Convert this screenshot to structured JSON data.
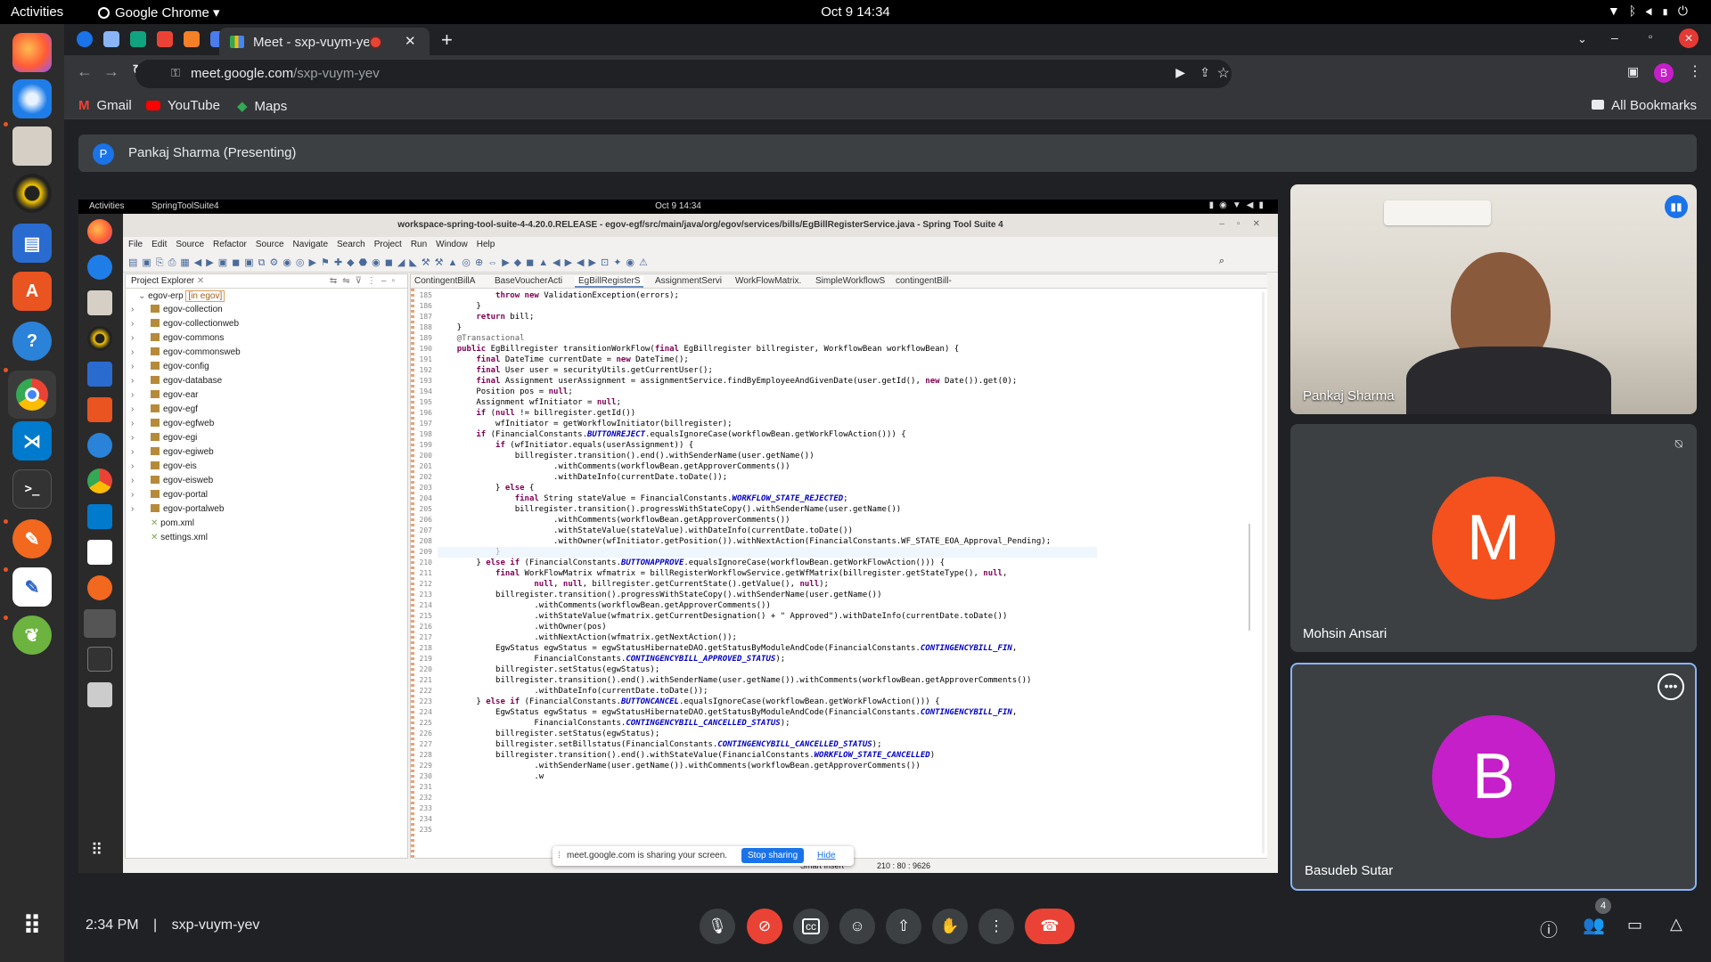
{
  "topbar": {
    "activities": "Activities",
    "app_name": "Google Chrome ▾",
    "clock": "Oct 9  14:34"
  },
  "chrome": {
    "active_tab_title": "Meet - sxp-vuym-yev",
    "new_tab": "+",
    "url_domain": "meet.google.com",
    "url_path": "/sxp-vuym-yev",
    "profile_initial": "B",
    "bookmarks": [
      {
        "label": "Gmail"
      },
      {
        "label": "YouTube"
      },
      {
        "label": "Maps"
      }
    ],
    "all_bookmarks": "All Bookmarks"
  },
  "meet": {
    "presenter_initial": "P",
    "presenter_label": "Pankaj Sharma (Presenting)",
    "time": "2:34 PM",
    "divider": "|",
    "meeting_code": "sxp-vuym-yev",
    "people_count": "4",
    "participants": [
      {
        "name": "Pankaj Sharma"
      },
      {
        "name": "Mohsin Ansari",
        "initial": "M",
        "color": "#f4511e"
      },
      {
        "name": "Basudeb Sutar",
        "initial": "B",
        "color": "#c51fc9"
      }
    ]
  },
  "shared_screen": {
    "activities": "Activities",
    "app_name": "SpringToolSuite4",
    "clock": "Oct 9  14:34",
    "window_title": "workspace-spring-tool-suite-4-4.20.0.RELEASE - egov-egf/src/main/java/org/egov/services/bills/EgBillRegisterService.java - Spring Tool Suite 4",
    "menu": [
      "File",
      "Edit",
      "Source",
      "Refactor",
      "Source",
      "Navigate",
      "Search",
      "Project",
      "Run",
      "Window",
      "Help"
    ],
    "project_explorer_label": "Project Explorer",
    "root_project": "egov-erp",
    "root_branch": "[in egov]",
    "projects": [
      "egov-collection",
      "egov-collectionweb",
      "egov-commons",
      "egov-commonsweb",
      "egov-config",
      "egov-database",
      "egov-ear",
      "egov-egf",
      "egov-egfweb",
      "egov-egi",
      "egov-egiweb",
      "egov-eis",
      "egov-eisweb",
      "egov-portal",
      "egov-portalweb"
    ],
    "files": [
      "pom.xml",
      "settings.xml"
    ],
    "editor_tabs": [
      "ContingentBillA",
      "BaseVoucherActi",
      "EgBillRegisterS",
      "AssignmentServi",
      "WorkFlowMatrix.",
      "SimpleWorkflowS",
      "contingentBill-"
    ],
    "line_start": 185,
    "code_lines": [
      "            throw new ValidationException(errors);",
      "        }",
      "        return bill;",
      "    }",
      "",
      "    @Transactional",
      "    public EgBillregister transitionWorkFlow(final EgBillregister billregister, WorkflowBean workflowBean) {",
      "        final DateTime currentDate = new DateTime();",
      "        final User user = securityUtils.getCurrentUser();",
      "        final Assignment userAssignment = assignmentService.findByEmployeeAndGivenDate(user.getId(), new Date()).get(0);",
      "        Position pos = null;",
      "        Assignment wfInitiator = null;",
      "        if (null != billregister.getId())",
      "            wfInitiator = getWorkflowInitiator(billregister);",
      "",
      "        if (FinancialConstants.BUTTONREJECT.equalsIgnoreCase(workflowBean.getWorkFlowAction())) {",
      "            if (wfInitiator.equals(userAssignment)) {",
      "                billregister.transition().end().withSenderName(user.getName())",
      "                        .withComments(workflowBean.getApproverComments())",
      "                        .withDateInfo(currentDate.toDate());",
      "            } else {",
      "                final String stateValue = FinancialConstants.WORKFLOW_STATE_REJECTED;",
      "                billregister.transition().progressWithStateCopy().withSenderName(user.getName())",
      "                        .withComments(workflowBean.getApproverComments())",
      "                        .withStateValue(stateValue).withDateInfo(currentDate.toDate())",
      "                        .withOwner(wfInitiator.getPosition()).withNextAction(FinancialConstants.WF_STATE_EOA_Approval_Pending);",
      "            }",
      "",
      "        } else if (FinancialConstants.BUTTONAPPROVE.equalsIgnoreCase(workflowBean.getWorkFlowAction())) {",
      "",
      "            final WorkFlowMatrix wfmatrix = billRegisterWorkflowService.getWfMatrix(billregister.getStateType(), null,",
      "                    null, null, billregister.getCurrentState().getValue(), null);",
      "            billregister.transition().progressWithStateCopy().withSenderName(user.getName())",
      "                    .withComments(workflowBean.getApproverComments())",
      "                    .withStateValue(wfmatrix.getCurrentDesignation() + \" Approved\").withDateInfo(currentDate.toDate())",
      "                    .withOwner(pos)",
      "                    .withNextAction(wfmatrix.getNextAction());",
      "",
      "            EgwStatus egwStatus = egwStatusHibernateDAO.getStatusByModuleAndCode(FinancialConstants.CONTINGENCYBILL_FIN,",
      "                    FinancialConstants.CONTINGENCYBILL_APPROVED_STATUS);",
      "            billregister.setStatus(egwStatus);",
      "            billregister.transition().end().withSenderName(user.getName()).withComments(workflowBean.getApproverComments())",
      "                    .withDateInfo(currentDate.toDate());",
      "        } else if (FinancialConstants.BUTTONCANCEL.equalsIgnoreCase(workflowBean.getWorkFlowAction())) {",
      "            EgwStatus egwStatus = egwStatusHibernateDAO.getStatusByModuleAndCode(FinancialConstants.CONTINGENCYBILL_FIN,",
      "                    FinancialConstants.CONTINGENCYBILL_CANCELLED_STATUS);",
      "            billregister.setStatus(egwStatus);",
      "            billregister.setBillstatus(FinancialConstants.CONTINGENCYBILL_CANCELLED_STATUS);",
      "            billregister.transition().end().withStateValue(FinancialConstants.WORKFLOW_STATE_CANCELLED)",
      "                    .withSenderName(user.getName()).withComments(workflowBean.getApproverComments())",
      "                    .w"
    ],
    "sharing_notice": "meet.google.com is sharing your screen.",
    "stop_sharing": "Stop sharing",
    "hide": "Hide",
    "insert_mode": "Smart Insert",
    "cursor_pos": "210 : 80 : 9626"
  }
}
